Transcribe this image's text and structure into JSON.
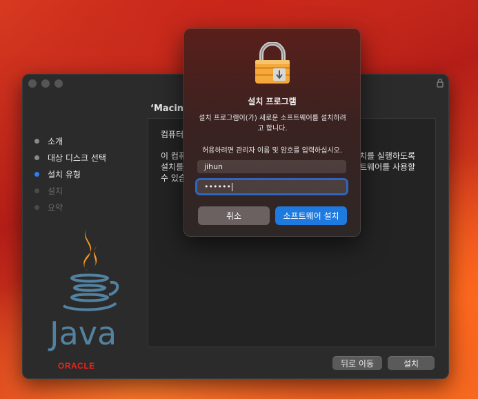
{
  "installer": {
    "title": "‘Macintosh HD’에 표준 설치",
    "title_visible": "‘Macinto",
    "steps": [
      {
        "label": "소개",
        "state": "done"
      },
      {
        "label": "대상 디스크 선택",
        "state": "done"
      },
      {
        "label": "설치 유형",
        "state": "active"
      },
      {
        "label": "설치",
        "state": "disabled"
      },
      {
        "label": "요약",
        "state": "disabled"
      }
    ],
    "content": {
      "line1": "컴퓨터",
      "line2a": "이 컴퓨",
      "line2b": "설치를",
      "line2c": "수 있습",
      "right1": "치를 실행하도록",
      "right2": "트웨어를 사용할"
    },
    "java_text": "Java",
    "oracle_text": "ORACLE",
    "back_label": "뒤로 이동",
    "install_label": "설치"
  },
  "dialog": {
    "title": "설치 프로그램",
    "message": "설치 프로그램이(가) 새로운 소프트웨어를 설치하려고 합니다.",
    "hint": "허용하려면 관리자 이름 및 암호를 입력하십시오.",
    "username": "jihun",
    "password_mask": "••••••",
    "cancel_label": "취소",
    "confirm_label": "소프트웨어 설치"
  },
  "colors": {
    "accent": "#2f7cf6",
    "confirm": "#1f7ae0",
    "oracle": "#e8261c",
    "java_blue": "#5382a1",
    "java_orange": "#f89820"
  }
}
